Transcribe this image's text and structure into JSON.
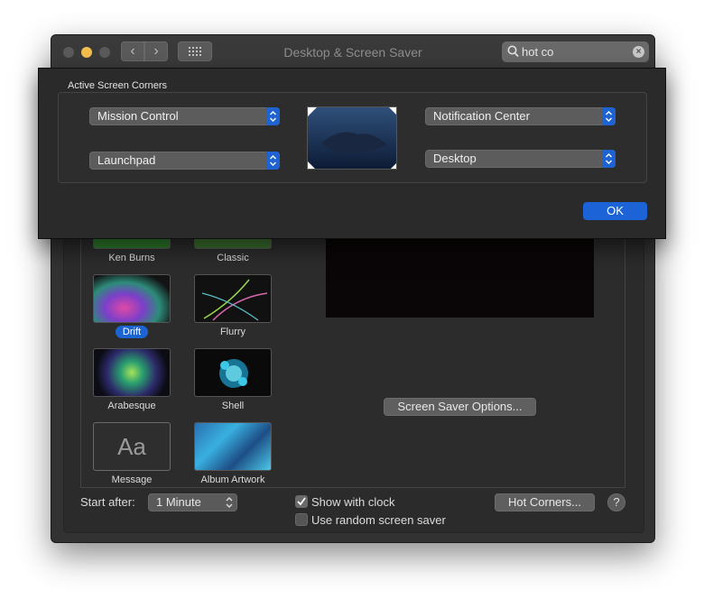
{
  "window": {
    "title": "Desktop & Screen Saver"
  },
  "search": {
    "value": "hot co"
  },
  "savers": [
    {
      "label": "Ken Burns"
    },
    {
      "label": "Classic"
    },
    {
      "label": "Drift"
    },
    {
      "label": "Flurry"
    },
    {
      "label": "Arabesque"
    },
    {
      "label": "Shell"
    },
    {
      "label": "Message",
      "glyph": "Aa"
    },
    {
      "label": "Album Artwork"
    }
  ],
  "selected_saver": "Drift",
  "options_button": "Screen Saver Options...",
  "bottom": {
    "start_after_label": "Start after:",
    "start_after_value": "1 Minute",
    "show_clock_label": "Show with clock",
    "show_clock_checked": true,
    "random_label": "Use random screen saver",
    "random_checked": false,
    "hot_corners_button": "Hot Corners...",
    "help": "?"
  },
  "sheet": {
    "title": "Active Screen Corners",
    "top_left": "Mission Control",
    "bottom_left": "Launchpad",
    "top_right": "Notification Center",
    "bottom_right": "Desktop",
    "ok": "OK"
  },
  "colors": {
    "accent": "#1b63d6",
    "window_bg": "#323232"
  }
}
